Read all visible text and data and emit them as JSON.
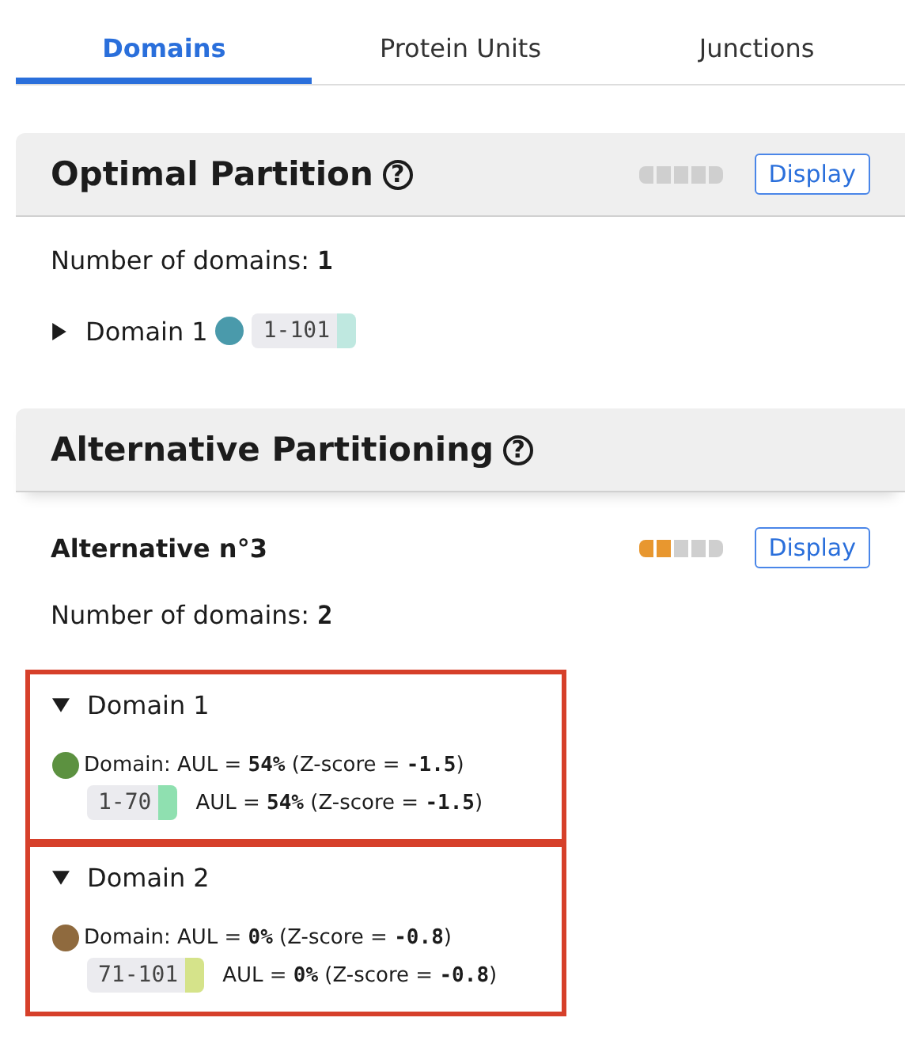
{
  "tabs": [
    {
      "label": "Domains",
      "selected": true
    },
    {
      "label": "Protein Units",
      "selected": false
    },
    {
      "label": "Junctions",
      "selected": false
    }
  ],
  "optimal": {
    "title": "Optimal Partition",
    "help": "?",
    "button": "Display",
    "count_text": "Number of domains: **1**",
    "domains": [
      {
        "label": "Domain 1",
        "expanded": false,
        "color": "#4a9aab",
        "range": {
          "text": "1-101",
          "color": "#bfe8e0"
        }
      }
    ]
  },
  "alternative": {
    "title": "Alternative Partitioning",
    "help": "?",
    "items": [
      {
        "title": "Alternative n°3",
        "quality": {
          "level": 0.4
        },
        "button": "Display",
        "count_text": "Number of domains: **2**",
        "domains": [
          {
            "label": "Domain 1",
            "expanded": true,
            "highlighted": true,
            "color": "#5c9140",
            "summary": "Domain: AUL = **54%** (Z-score = **-1.5**)",
            "range": {
              "text": "1-70",
              "color": "#8fe0b0"
            },
            "range_text": "AUL = **54%** (Z-score = **-1.5**)"
          },
          {
            "label": "Domain 2",
            "expanded": true,
            "highlighted": true,
            "color": "#8f6a3e",
            "summary": "Domain: AUL = **0%** (Z-score = **-0.8**)",
            "range": {
              "text": "71-101",
              "color": "#d5e38a"
            },
            "range_text": "AUL = **0%** (Z-score = **-0.8**)"
          }
        ]
      }
    ]
  }
}
